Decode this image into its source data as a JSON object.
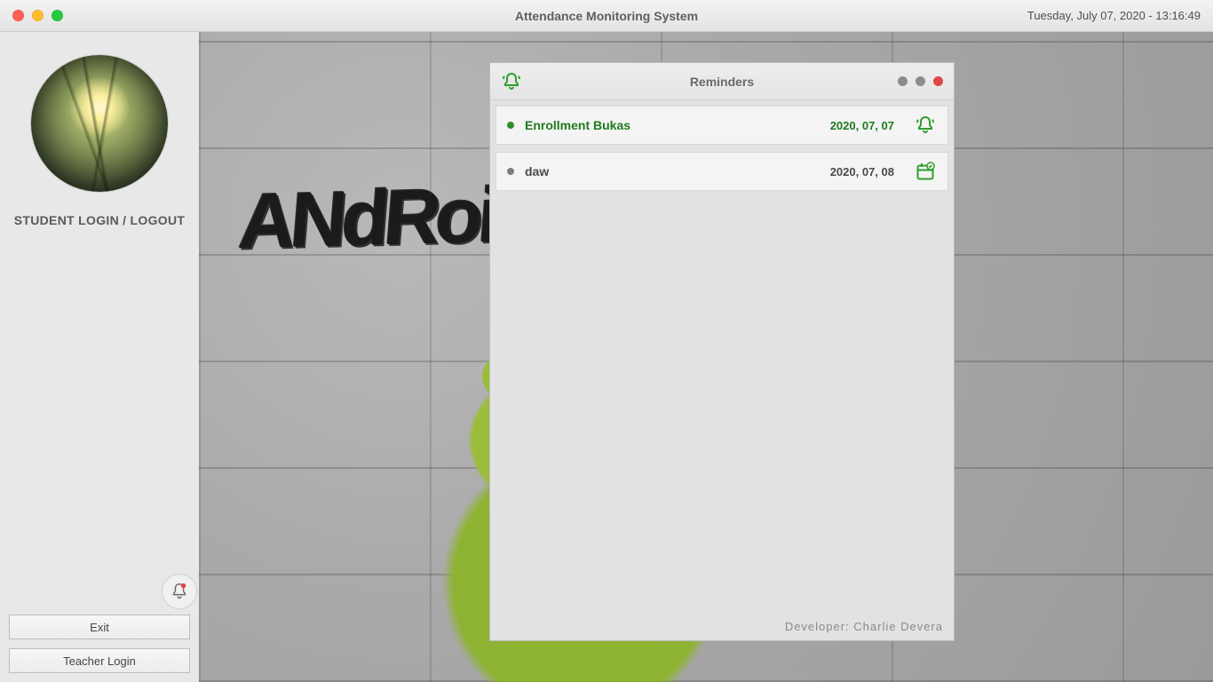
{
  "window": {
    "title": "Attendance Monitoring System",
    "datetime": "Tuesday, July  07, 2020 - 13:16:49"
  },
  "sidebar": {
    "student_login_label": "STUDENT LOGIN / LOGOUT",
    "exit_label": "Exit",
    "teacher_login_label": "Teacher Login"
  },
  "graffiti": "ANdRoiD",
  "panel": {
    "title": "Reminders",
    "footer": "Developer: Charlie Devera",
    "items": [
      {
        "title": "Enrollment Bukas",
        "date": "2020, 07, 07",
        "active": true,
        "icon": "bell"
      },
      {
        "title": "daw",
        "date": "2020, 07, 08",
        "active": false,
        "icon": "calendar"
      }
    ]
  },
  "colors": {
    "accent_green": "#2f9e2f",
    "accent_green_dark": "#1e7a1e"
  }
}
